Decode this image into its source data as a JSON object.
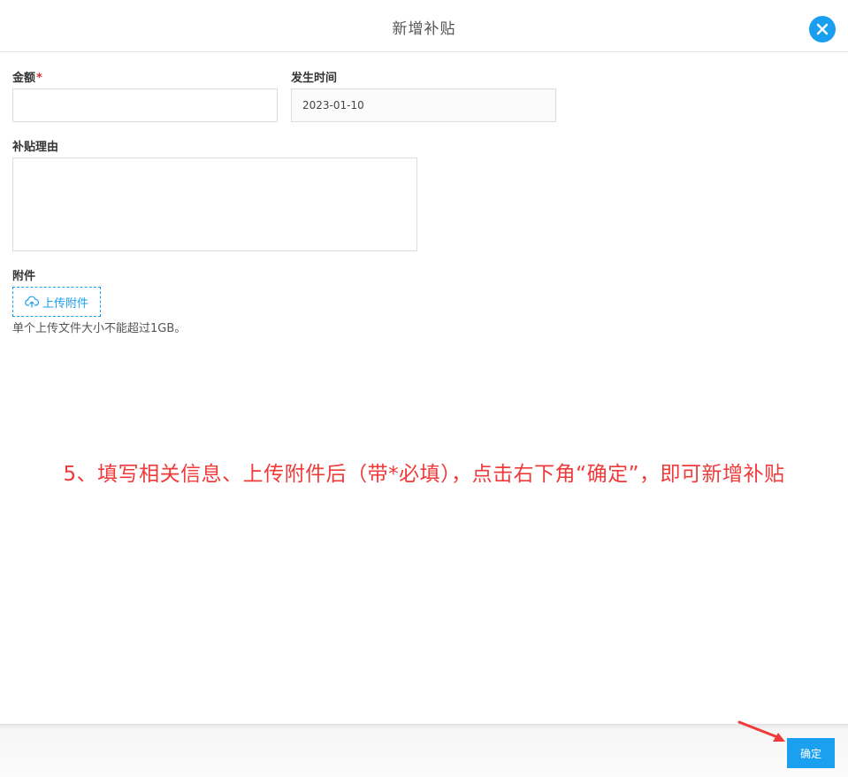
{
  "dialog": {
    "title": "新增补贴",
    "close_icon": "close-icon"
  },
  "form": {
    "amount": {
      "label": "金额",
      "required_mark": "*",
      "value": ""
    },
    "occur_time": {
      "label": "发生时间",
      "value": "2023-01-10"
    },
    "reason": {
      "label": "补贴理由",
      "value": ""
    },
    "attachment": {
      "label": "附件",
      "upload_label": "上传附件",
      "upload_icon": "cloud-upload-icon",
      "hint": "单个上传文件大小不能超过1GB。"
    }
  },
  "annotation": {
    "text": "5、填写相关信息、上传附件后（带*必填），点击右下角“确定”，即可新增补贴",
    "color": "#f03a3a"
  },
  "footer": {
    "confirm_label": "确定"
  },
  "colors": {
    "accent": "#1a9ff0",
    "required": "#e02d2d",
    "arrow": "#f03a3a"
  }
}
